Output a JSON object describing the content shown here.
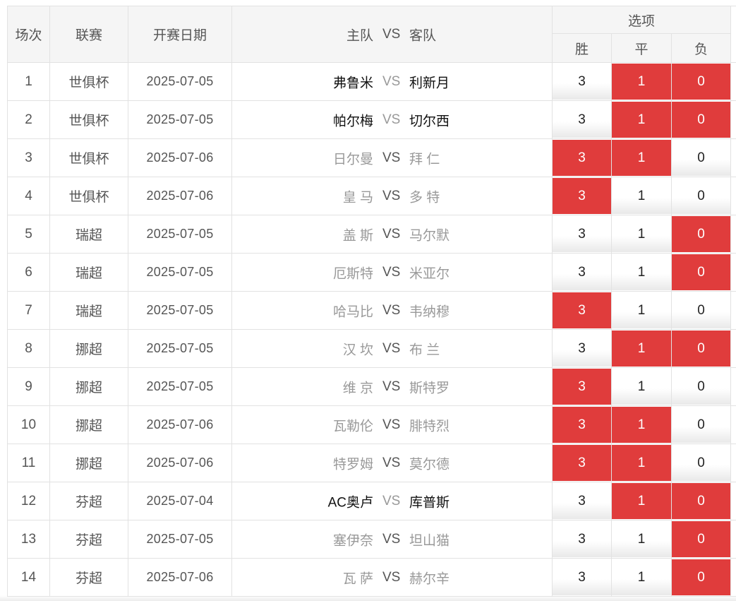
{
  "header": {
    "col_index": "场次",
    "col_league": "联赛",
    "col_date": "开赛日期",
    "col_home": "主队",
    "col_vs": "VS",
    "col_away": "客队",
    "col_options": "选项",
    "opt_win": "胜",
    "opt_draw": "平",
    "opt_lose": "负"
  },
  "vs_text": "VS",
  "rows": [
    {
      "index": "1",
      "league": "世俱杯",
      "date": "2025-07-05",
      "home": "弗鲁米",
      "away": "利新月",
      "highlight": true,
      "win": "3",
      "draw": "1",
      "lose": "0",
      "win_on": false,
      "draw_on": true,
      "lose_on": true
    },
    {
      "index": "2",
      "league": "世俱杯",
      "date": "2025-07-05",
      "home": "帕尔梅",
      "away": "切尔西",
      "highlight": true,
      "win": "3",
      "draw": "1",
      "lose": "0",
      "win_on": false,
      "draw_on": true,
      "lose_on": true
    },
    {
      "index": "3",
      "league": "世俱杯",
      "date": "2025-07-06",
      "home": "日尔曼",
      "away": "拜 仁",
      "highlight": false,
      "win": "3",
      "draw": "1",
      "lose": "0",
      "win_on": true,
      "draw_on": true,
      "lose_on": false
    },
    {
      "index": "4",
      "league": "世俱杯",
      "date": "2025-07-06",
      "home": "皇 马",
      "away": "多 特",
      "highlight": false,
      "win": "3",
      "draw": "1",
      "lose": "0",
      "win_on": true,
      "draw_on": false,
      "lose_on": false
    },
    {
      "index": "5",
      "league": "瑞超",
      "date": "2025-07-05",
      "home": "盖 斯",
      "away": "马尔默",
      "highlight": false,
      "win": "3",
      "draw": "1",
      "lose": "0",
      "win_on": false,
      "draw_on": false,
      "lose_on": true
    },
    {
      "index": "6",
      "league": "瑞超",
      "date": "2025-07-05",
      "home": "厄斯特",
      "away": "米亚尔",
      "highlight": false,
      "win": "3",
      "draw": "1",
      "lose": "0",
      "win_on": false,
      "draw_on": false,
      "lose_on": true
    },
    {
      "index": "7",
      "league": "瑞超",
      "date": "2025-07-05",
      "home": "哈马比",
      "away": "韦纳穆",
      "highlight": false,
      "win": "3",
      "draw": "1",
      "lose": "0",
      "win_on": true,
      "draw_on": false,
      "lose_on": false
    },
    {
      "index": "8",
      "league": "挪超",
      "date": "2025-07-05",
      "home": "汉 坎",
      "away": "布 兰",
      "highlight": false,
      "win": "3",
      "draw": "1",
      "lose": "0",
      "win_on": false,
      "draw_on": true,
      "lose_on": true
    },
    {
      "index": "9",
      "league": "挪超",
      "date": "2025-07-05",
      "home": "维 京",
      "away": "斯特罗",
      "highlight": false,
      "win": "3",
      "draw": "1",
      "lose": "0",
      "win_on": true,
      "draw_on": false,
      "lose_on": false
    },
    {
      "index": "10",
      "league": "挪超",
      "date": "2025-07-06",
      "home": "瓦勒伦",
      "away": "腓特烈",
      "highlight": false,
      "win": "3",
      "draw": "1",
      "lose": "0",
      "win_on": true,
      "draw_on": true,
      "lose_on": false
    },
    {
      "index": "11",
      "league": "挪超",
      "date": "2025-07-06",
      "home": "特罗姆",
      "away": "莫尔德",
      "highlight": false,
      "win": "3",
      "draw": "1",
      "lose": "0",
      "win_on": true,
      "draw_on": true,
      "lose_on": false
    },
    {
      "index": "12",
      "league": "芬超",
      "date": "2025-07-04",
      "home": "AC奥卢",
      "away": "库普斯",
      "highlight": true,
      "win": "3",
      "draw": "1",
      "lose": "0",
      "win_on": false,
      "draw_on": true,
      "lose_on": true
    },
    {
      "index": "13",
      "league": "芬超",
      "date": "2025-07-05",
      "home": "塞伊奈",
      "away": "坦山猫",
      "highlight": false,
      "win": "3",
      "draw": "1",
      "lose": "0",
      "win_on": false,
      "draw_on": false,
      "lose_on": true
    },
    {
      "index": "14",
      "league": "芬超",
      "date": "2025-07-06",
      "home": "瓦 萨",
      "away": "赫尔辛",
      "highlight": false,
      "win": "3",
      "draw": "1",
      "lose": "0",
      "win_on": false,
      "draw_on": false,
      "lose_on": true
    }
  ],
  "colors": {
    "selected": "#e03c3c",
    "header_bg": "#f5f5f5",
    "border": "#e2e2e2",
    "dim_text": "#999999"
  }
}
